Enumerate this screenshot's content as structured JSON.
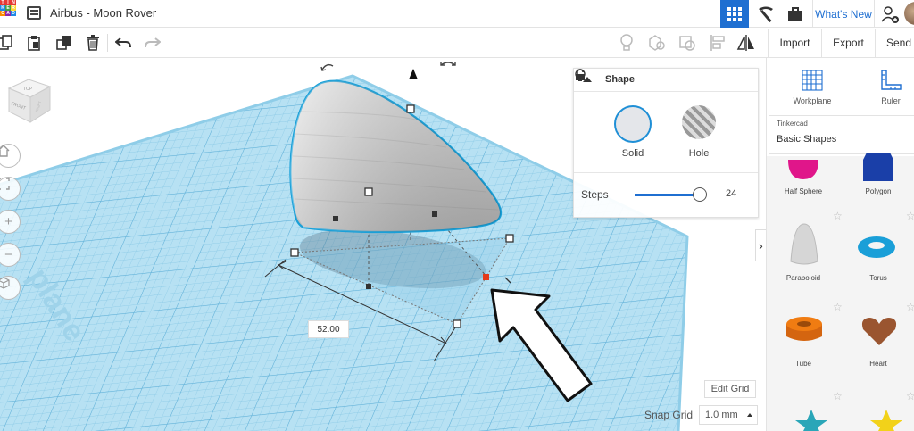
{
  "app": {
    "logo_letters": [
      "T",
      "I",
      "N",
      "K",
      "E",
      "R",
      "C",
      "A",
      "D"
    ],
    "document_title": "Airbus - Moon Rover"
  },
  "topbar": {
    "whats_new_label": "What's New"
  },
  "toolbar": {
    "import_label": "Import",
    "export_label": "Export",
    "send_label": "Send To"
  },
  "shape_panel": {
    "title": "Shape",
    "solid_label": "Solid",
    "hole_label": "Hole",
    "steps_label": "Steps",
    "steps_value": "24",
    "steps_fraction": 0.96
  },
  "workplane": {
    "dimension_value": "52.00",
    "edit_grid_label": "Edit Grid",
    "snap_grid_label": "Snap Grid",
    "snap_grid_value": "1.0 mm",
    "watermark_text": "plane"
  },
  "viewcube": {
    "top_label": "TOP",
    "front_label": "FRONT",
    "side_label": "RIGHT"
  },
  "sidebar": {
    "workplane_label": "Workplane",
    "ruler_label": "Ruler",
    "library_source": "Tinkercad",
    "library_name": "Basic Shapes",
    "shapes": [
      {
        "name": "Half Sphere",
        "color": "#e0168a"
      },
      {
        "name": "Polygon",
        "color": "#1a3fa8"
      },
      {
        "name": "Paraboloid",
        "color": "#d8d8d8"
      },
      {
        "name": "Torus",
        "color": "#1a9fd8"
      },
      {
        "name": "Tube",
        "color": "#f07c12"
      },
      {
        "name": "Heart",
        "color": "#9a5530"
      }
    ]
  },
  "colors": {
    "accent": "#1f6fd1",
    "workplane": "#a8d8ee",
    "selection_outline": "#1aa0d8"
  }
}
